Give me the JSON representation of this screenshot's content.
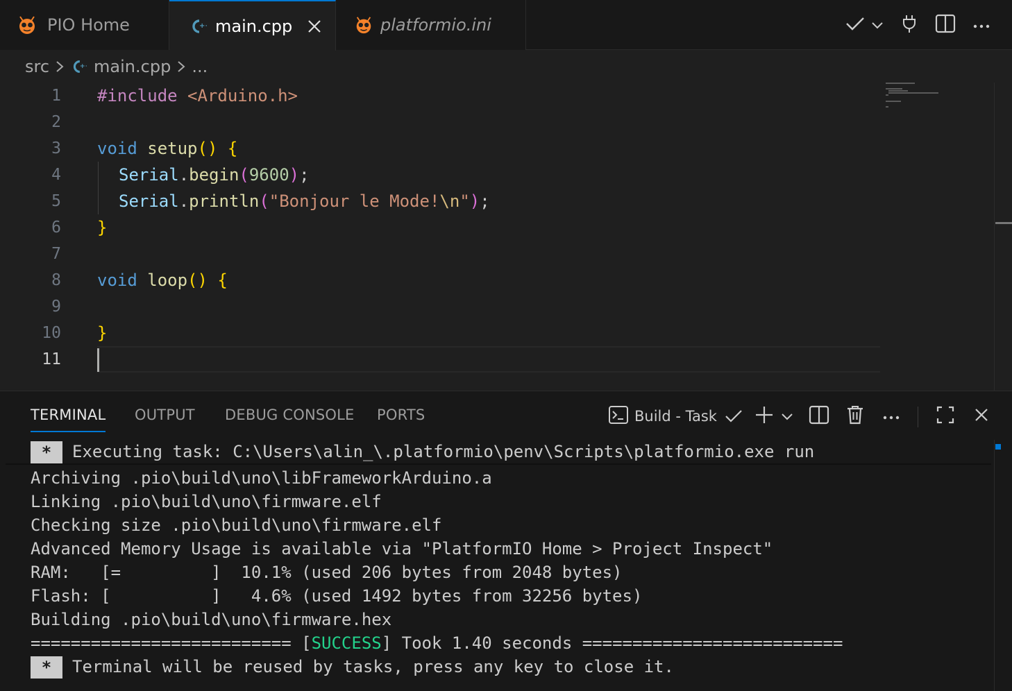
{
  "tabs": [
    {
      "label": "PIO Home",
      "icon": "platformio-ant-icon",
      "active": false
    },
    {
      "label": "main.cpp",
      "icon": "cpp-file-icon",
      "active": true
    },
    {
      "label": "platformio.ini",
      "icon": "platformio-ant-icon",
      "active": false
    }
  ],
  "breadcrumb": {
    "folder": "src",
    "file": "main.cpp",
    "more": "..."
  },
  "editor": {
    "line_numbers": [
      "1",
      "2",
      "3",
      "4",
      "5",
      "6",
      "7",
      "8",
      "9",
      "10",
      "11"
    ],
    "current_line": "11",
    "code": {
      "l1_pp": "#include",
      "l1_inc": "<Arduino.h>",
      "l3_kw": "void",
      "l3_fn": "setup",
      "l3_par": "()",
      "l3_br": "{",
      "l4_obj": "Serial",
      "l4_dot": ".",
      "l4_fn": "begin",
      "l4_open": "(",
      "l4_num": "9600",
      "l4_close": ")",
      "l4_semi": ";",
      "l5_obj": "Serial",
      "l5_dot": ".",
      "l5_fn": "println",
      "l5_open": "(",
      "l5_str1": "\"Bonjour le Mode!",
      "l5_esc": "\\n",
      "l5_str2": "\"",
      "l5_close": ")",
      "l5_semi": ";",
      "l6_br": "}",
      "l8_kw": "void",
      "l8_fn": "loop",
      "l8_par": "()",
      "l8_br": "{",
      "l10_br": "}"
    }
  },
  "panel": {
    "tabs": [
      "TERMINAL",
      "OUTPUT",
      "DEBUG CONSOLE",
      "PORTS"
    ],
    "active_tab": "TERMINAL",
    "task_name": "Build - Task",
    "terminal": {
      "badge": "*",
      "executing": "Executing task: C:\\Users\\alin_\\.platformio\\penv\\Scripts\\platformio.exe run",
      "lines": [
        "Archiving .pio\\build\\uno\\libFrameworkArduino.a",
        "Linking .pio\\build\\uno\\firmware.elf",
        "Checking size .pio\\build\\uno\\firmware.elf",
        "Advanced Memory Usage is available via \"PlatformIO Home > Project Inspect\"",
        "RAM:   [=         ]  10.1% (used 206 bytes from 2048 bytes)",
        "Flash: [          ]   4.6% (used 1492 bytes from 32256 bytes)",
        "Building .pio\\build\\uno\\firmware.hex"
      ],
      "success_left": "========================== [",
      "success_word": "SUCCESS",
      "success_right": "] Took 1.40 seconds ==========================",
      "reuse": "Terminal will be reused by tasks, press any key to close it."
    }
  },
  "colors": {
    "accent": "#0078d4",
    "success": "#23d18b",
    "platformio_orange": "#f5822a"
  }
}
